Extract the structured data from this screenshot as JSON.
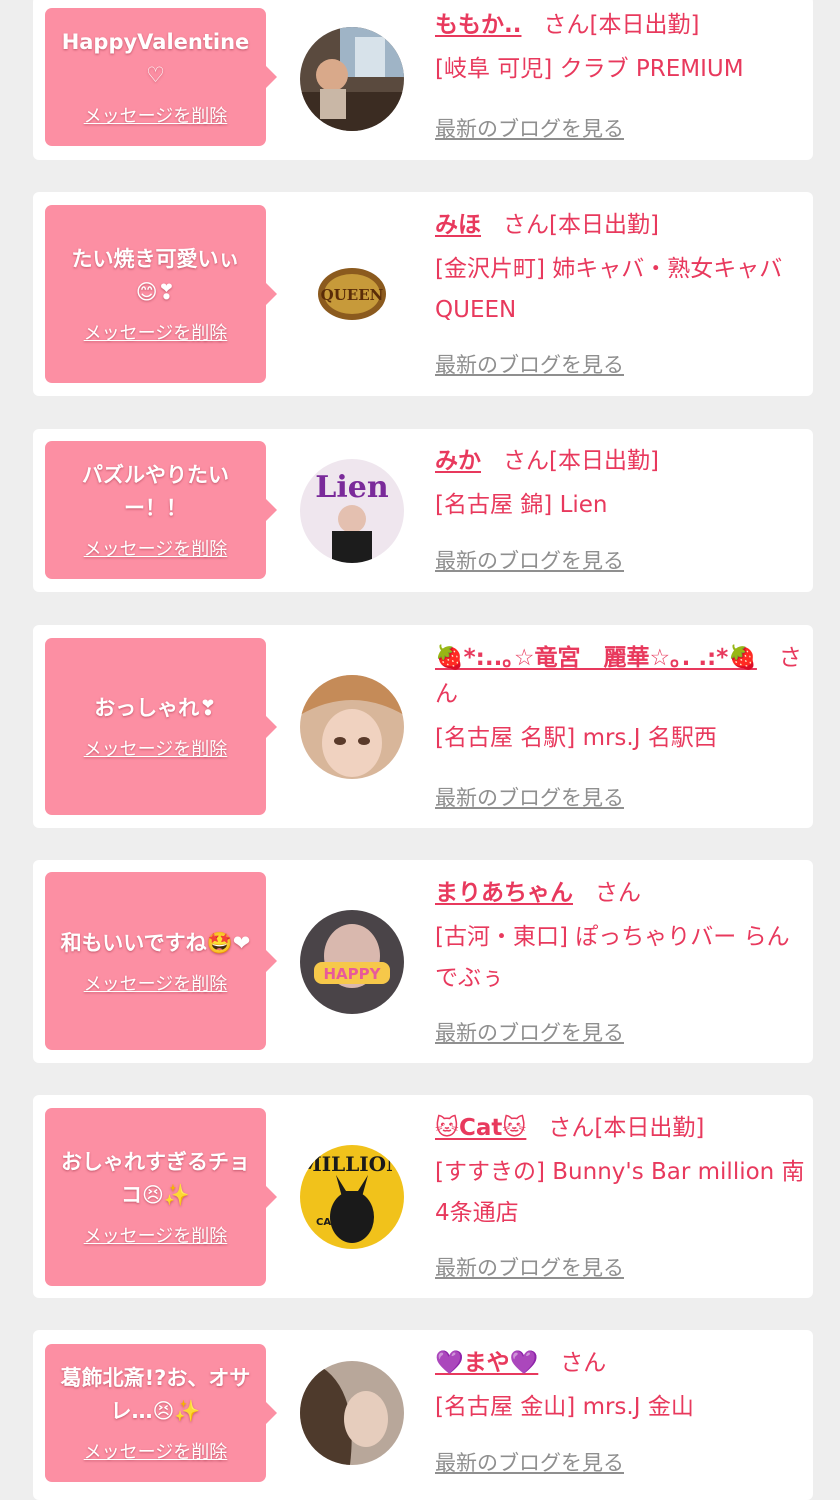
{
  "delete_label": "メッセージを削除",
  "blog_label": "最新のブログを見る",
  "honorific": "さん",
  "cards": [
    {
      "message": "HappyValentine♡",
      "name": "ももか..",
      "status": "さん[本日出勤]",
      "shop": "[岐阜 可児] クラブ PREMIUM"
    },
    {
      "message": "たい焼き可愛いぃ😊❣",
      "name": "みほ",
      "status": "さん[本日出勤]",
      "shop": "[金沢片町] 姉キャバ・熟女キャバ QUEEN"
    },
    {
      "message": "パズルやりたいー！！",
      "name": "みか",
      "status": "さん[本日出勤]",
      "shop": "[名古屋 錦] Lien"
    },
    {
      "message": "おっしゃれ❣",
      "name": "🍓*:..｡☆竜宮　麗華☆｡. .:*🍓",
      "status": "さん",
      "shop": "[名古屋 名駅] mrs.J 名駅西"
    },
    {
      "message": "和もいいですね🤩❤",
      "name": "まりあちゃん",
      "status": "さん",
      "shop": "[古河・東口] ぽっちゃりバー らんでぶぅ"
    },
    {
      "message": "おしゃれすぎるチョコ😣✨",
      "name": "🐱Cat🐱",
      "status": "さん[本日出勤]",
      "shop": "[すすきの] Bunny's Bar million 南4条通店"
    },
    {
      "message": "葛飾北斎!?お、オサレ…😣✨",
      "name": "💜まや💜",
      "status": "さん",
      "shop": "[名古屋 金山] mrs.J 金山"
    }
  ],
  "colors": {
    "accent": "#e8395d",
    "bubble": "#fc8fa3",
    "link_gray": "#8f8f8f",
    "background": "#eeeeee"
  },
  "avatar_icons": [
    "photo-avatar",
    "queen-logo-avatar",
    "lien-photo-avatar",
    "photo-avatar",
    "happy-photo-avatar",
    "million-cat-avatar",
    "photo-avatar"
  ]
}
